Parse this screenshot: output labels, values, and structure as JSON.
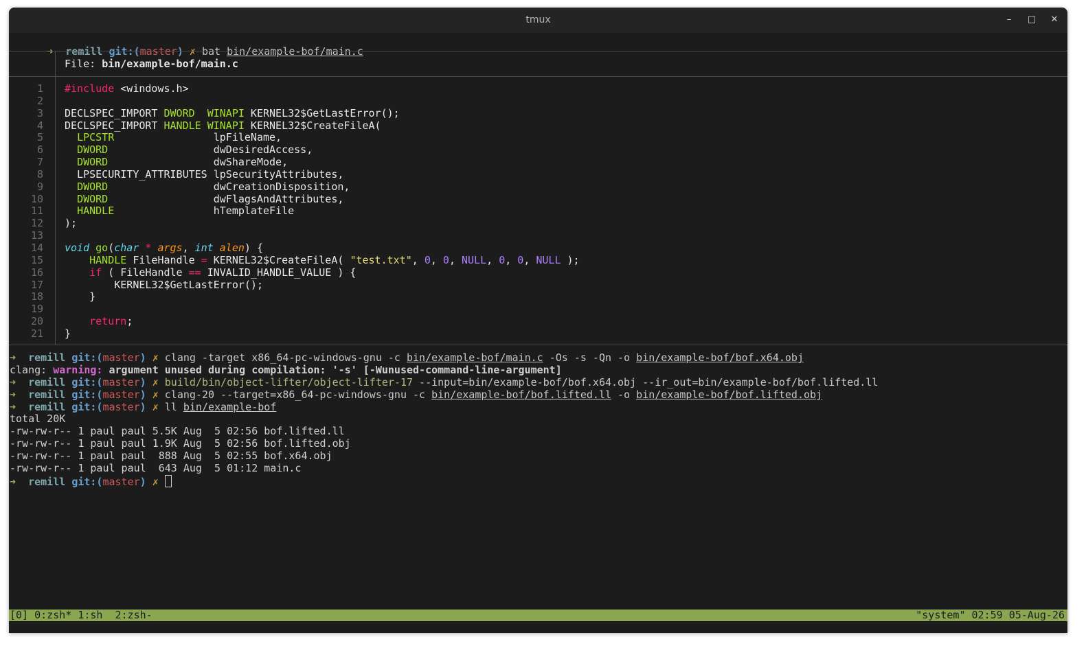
{
  "window": {
    "title": "tmux"
  },
  "prompt": {
    "arrow": "➜",
    "dir": "remill",
    "git_prefix": "git:(",
    "branch": "master",
    "git_suffix": ")",
    "dirty": "✗"
  },
  "cmd1": {
    "tool": "bat",
    "arg": "bin/example-bof/main.c"
  },
  "bat": {
    "file_label": "File: ",
    "file_name": "bin/example-bof/main.c",
    "line_numbers": [
      "1",
      "2",
      "3",
      "4",
      "5",
      "6",
      "7",
      "8",
      "9",
      "10",
      "11",
      "12",
      "13",
      "14",
      "15",
      "16",
      "17",
      "18",
      "19",
      "20",
      "21"
    ]
  },
  "code": {
    "l1": [
      "#include",
      " <windows.h>"
    ],
    "l3": [
      "DECLSPEC_IMPORT ",
      "DWORD",
      "  ",
      "WINAPI",
      " KERNEL32$GetLastError();"
    ],
    "l4": [
      "DECLSPEC_IMPORT ",
      "HANDLE",
      " ",
      "WINAPI",
      " KERNEL32$CreateFileA("
    ],
    "l5": [
      "  ",
      "LPCSTR",
      "                lpFileName,"
    ],
    "l6": [
      "  ",
      "DWORD",
      "                 dwDesiredAccess,"
    ],
    "l7": [
      "  ",
      "DWORD",
      "                 dwShareMode,"
    ],
    "l8": [
      "  LPSECURITY_ATTRIBUTES lpSecurityAttributes,"
    ],
    "l9": [
      "  ",
      "DWORD",
      "                 dwCreationDisposition,"
    ],
    "l10": [
      "  ",
      "DWORD",
      "                 dwFlagsAndAttributes,"
    ],
    "l11": [
      "  ",
      "HANDLE",
      "                hTemplateFile"
    ],
    "l12": [
      ");"
    ],
    "l14": [
      "void",
      " ",
      "go",
      "(",
      "char",
      " ",
      "*",
      " ",
      "args",
      ", ",
      "int",
      " ",
      "alen",
      ") {"
    ],
    "l15": [
      "    ",
      "HANDLE",
      " FileHandle ",
      "=",
      " KERNEL32$CreateFileA( ",
      "\"test.txt\"",
      ", ",
      "0",
      ", ",
      "0",
      ", ",
      "NULL",
      ", ",
      "0",
      ", ",
      "0",
      ", ",
      "NULL",
      " );"
    ],
    "l16": [
      "    ",
      "if",
      " ( FileHandle ",
      "==",
      " INVALID_HANDLE_VALUE ) {"
    ],
    "l17": [
      "        KERNEL32$GetLastError();"
    ],
    "l18": [
      "    }"
    ],
    "l20": [
      "    ",
      "return",
      ";"
    ],
    "l21": [
      "}"
    ]
  },
  "cmd2": {
    "pre": "clang -target x86_64-pc-windows-gnu -c ",
    "a1": "bin/example-bof/main.c",
    "mid": " -Os -s -Qn -o ",
    "a2": "bin/example-bof/bof.x64.obj"
  },
  "warn": {
    "prefix": "clang: ",
    "label": "warning:",
    "msg": " argument unused during compilation: '-s' [-Wunused-command-line-argument]"
  },
  "cmd3": {
    "tool": "build/bin/object-lifter/object-lifter-17",
    "args": " --input=bin/example-bof/bof.x64.obj --ir_out=bin/example-bof/bof.lifted.ll"
  },
  "cmd4": {
    "pre": "clang-20 --target=x86_64-pc-windows-gnu -c ",
    "a1": "bin/example-bof/bof.lifted.ll",
    "mid": " -o ",
    "a2": "bin/example-bof/bof.lifted.obj"
  },
  "cmd5": {
    "tool": "ll ",
    "arg": "bin/example-bof"
  },
  "ls": {
    "total": "total 20K",
    "rows": [
      "-rw-rw-r-- 1 paul paul 5.5K Aug  5 02:56 bof.lifted.ll",
      "-rw-rw-r-- 1 paul paul 1.9K Aug  5 02:56 bof.lifted.obj",
      "-rw-rw-r-- 1 paul paul  888 Aug  5 02:55 bof.x64.obj",
      "-rw-rw-r-- 1 paul paul  643 Aug  5 01:12 main.c"
    ]
  },
  "status": {
    "left": "[0] 0:zsh* 1:sh  2:zsh-",
    "right": "\"system\" 02:59 05-Aug-26"
  },
  "colors": {
    "status_bg": "#8aa651",
    "terminal_bg": "#1c1c1c",
    "keyword": "#f92672",
    "type": "#a6e22e",
    "string": "#e6db74",
    "number": "#ae81ff"
  }
}
